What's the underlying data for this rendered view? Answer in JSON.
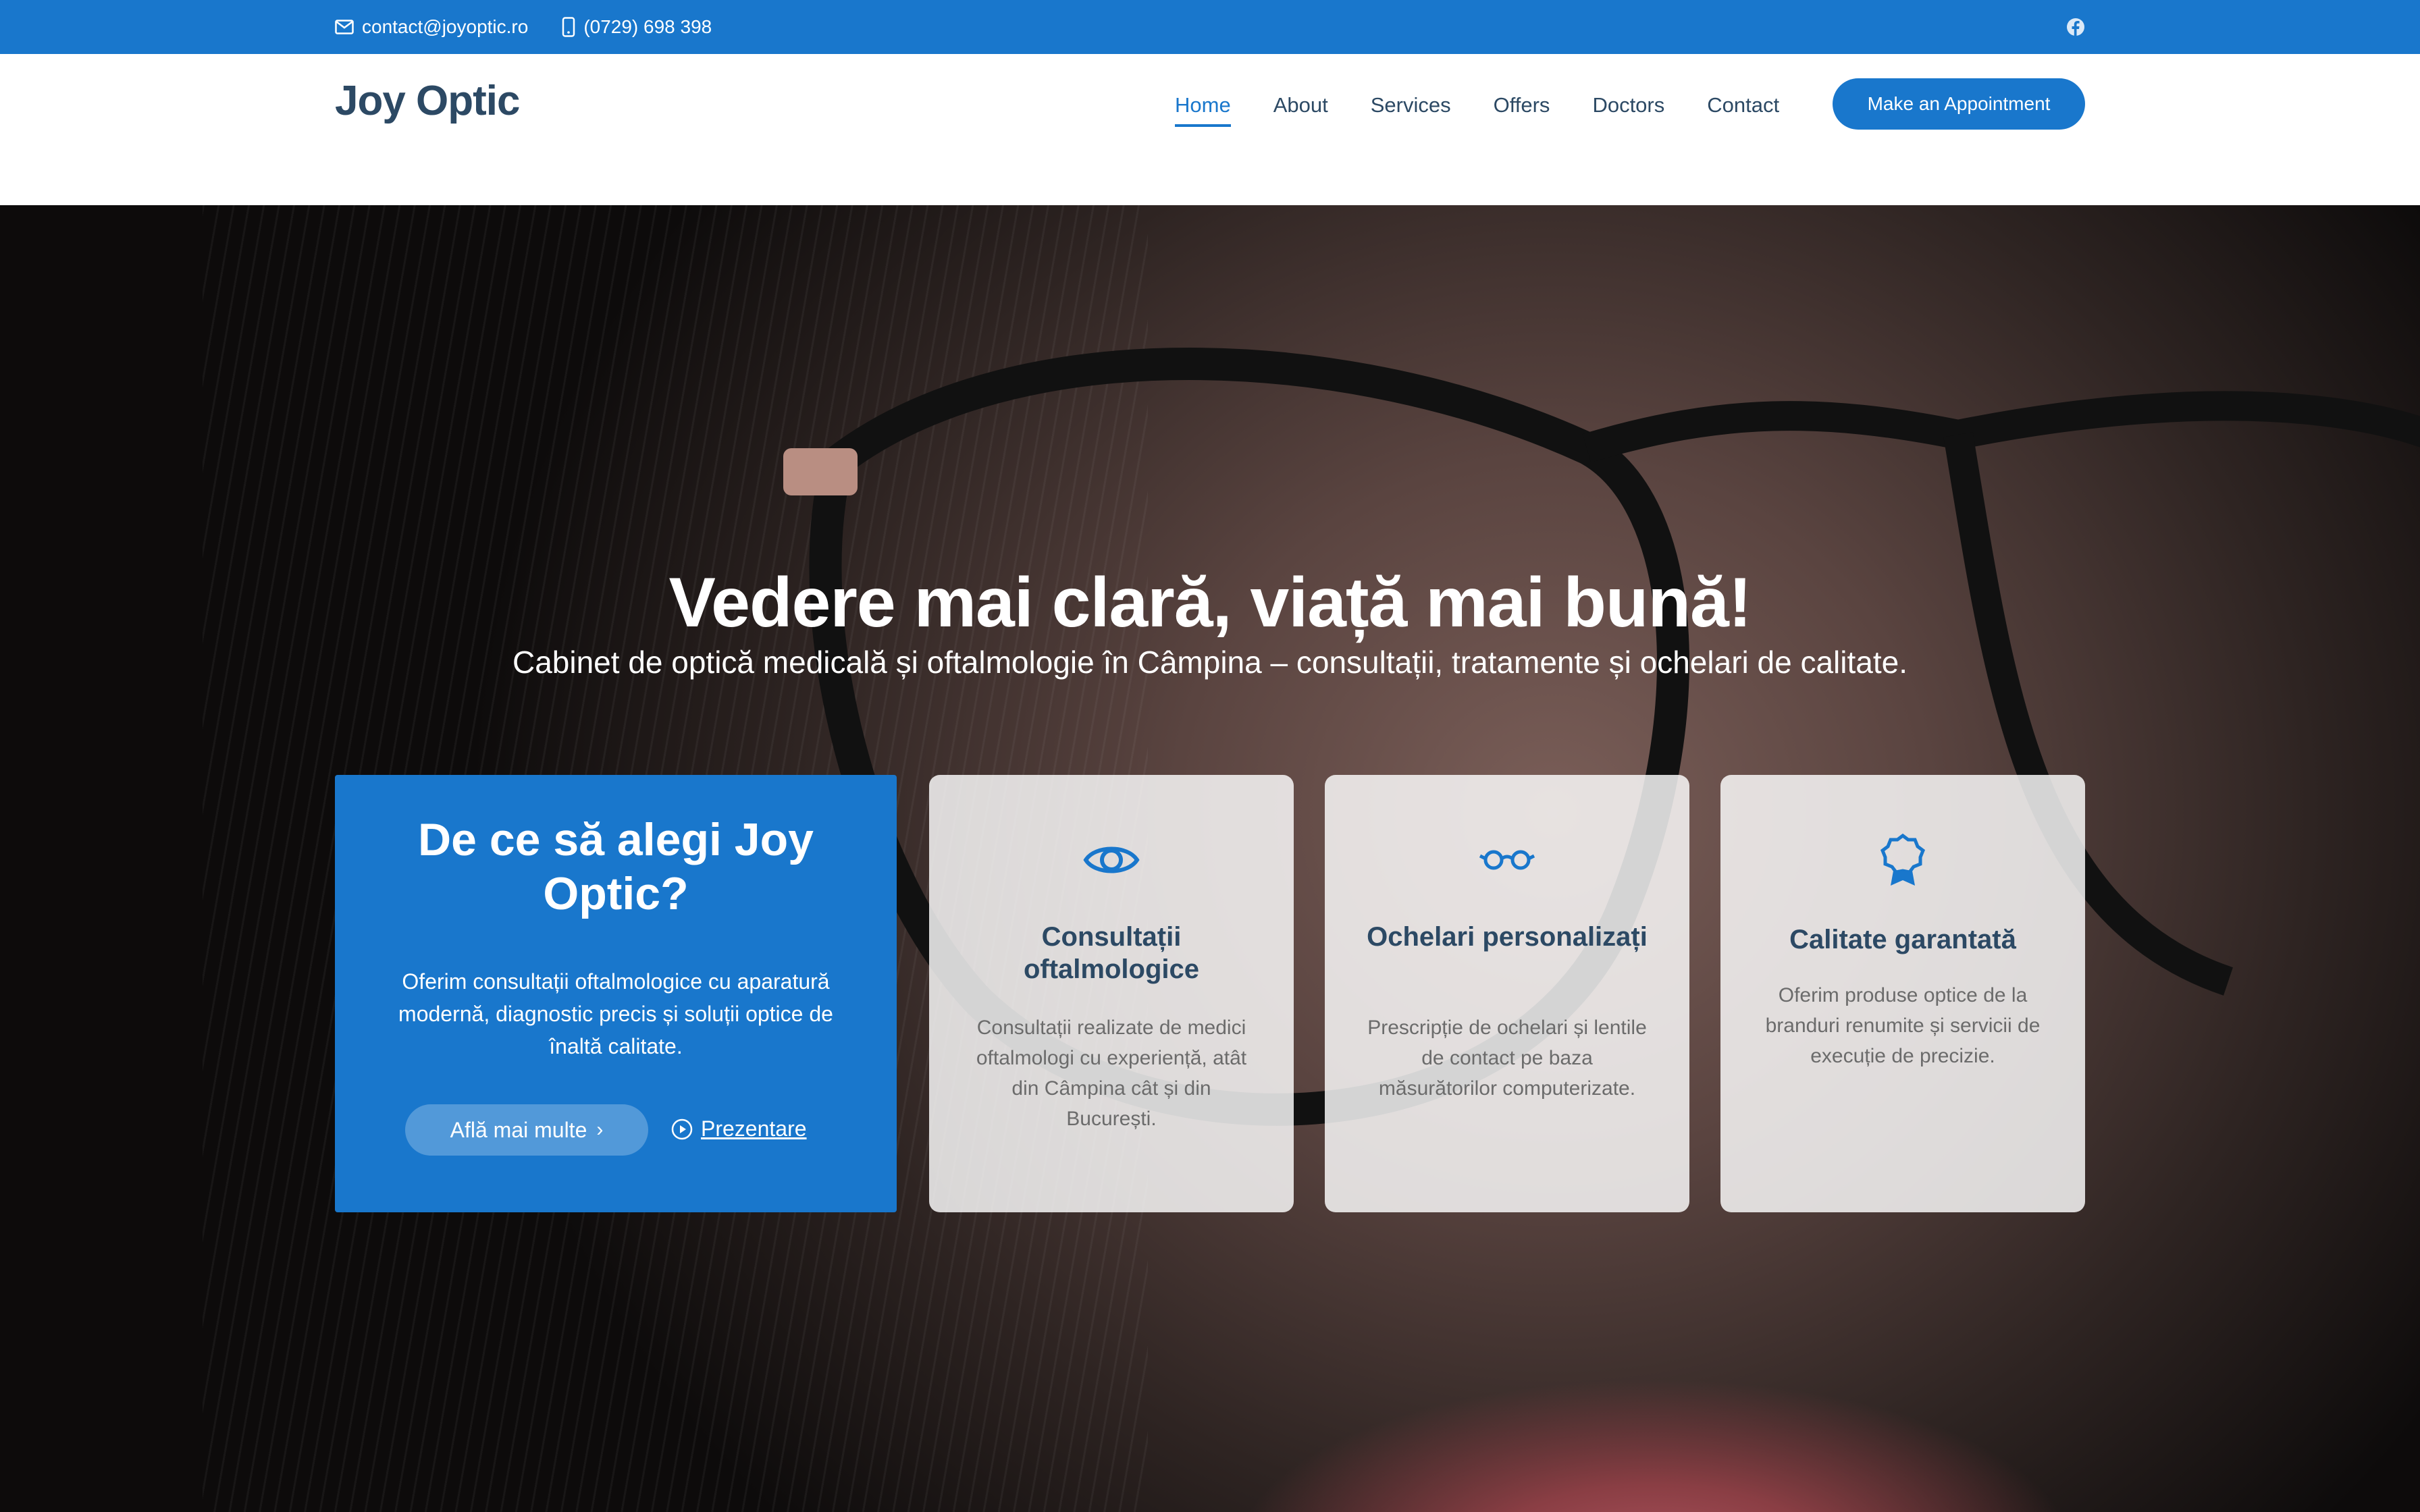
{
  "topbar": {
    "email": "contact@joyoptic.ro",
    "phone": "(0729) 698 398"
  },
  "header": {
    "logo": "Joy Optic",
    "nav": [
      {
        "label": "Home",
        "active": true
      },
      {
        "label": "About"
      },
      {
        "label": "Services"
      },
      {
        "label": "Offers"
      },
      {
        "label": "Doctors"
      },
      {
        "label": "Contact"
      }
    ],
    "appointment_button": "Make an Appointment"
  },
  "hero": {
    "title": "Vedere mai clară, viață mai bună!",
    "subtitle": "Cabinet de optică medicală și oftalmologie în Câmpina – consultații, tratamente și ochelari de calitate."
  },
  "why": {
    "title": "De ce să alegi Joy Optic?",
    "text": "Oferim consultații oftalmologice cu aparatură modernă, diagnostic precis și soluții optice de înaltă calitate.",
    "learn_more": "Află mai multe",
    "video_link": "Prezentare"
  },
  "cards": [
    {
      "icon": "eye-icon",
      "title": "Consultații oftalmologice",
      "text": "Consultații realizate de medici oftalmologi cu experiență, atât din Câmpina cât și din București."
    },
    {
      "icon": "glasses-icon",
      "title": "Ochelari personalizați",
      "text": "Prescripție de ochelari și lentile de contact pe baza măsurătorilor computerizate."
    },
    {
      "icon": "award-icon",
      "title": "Calitate garantată",
      "text": "Oferim produse optice de la branduri renumite și servicii de execuție de precizie."
    }
  ],
  "colors": {
    "accent": "#1977cc",
    "heading": "#2c4964"
  }
}
